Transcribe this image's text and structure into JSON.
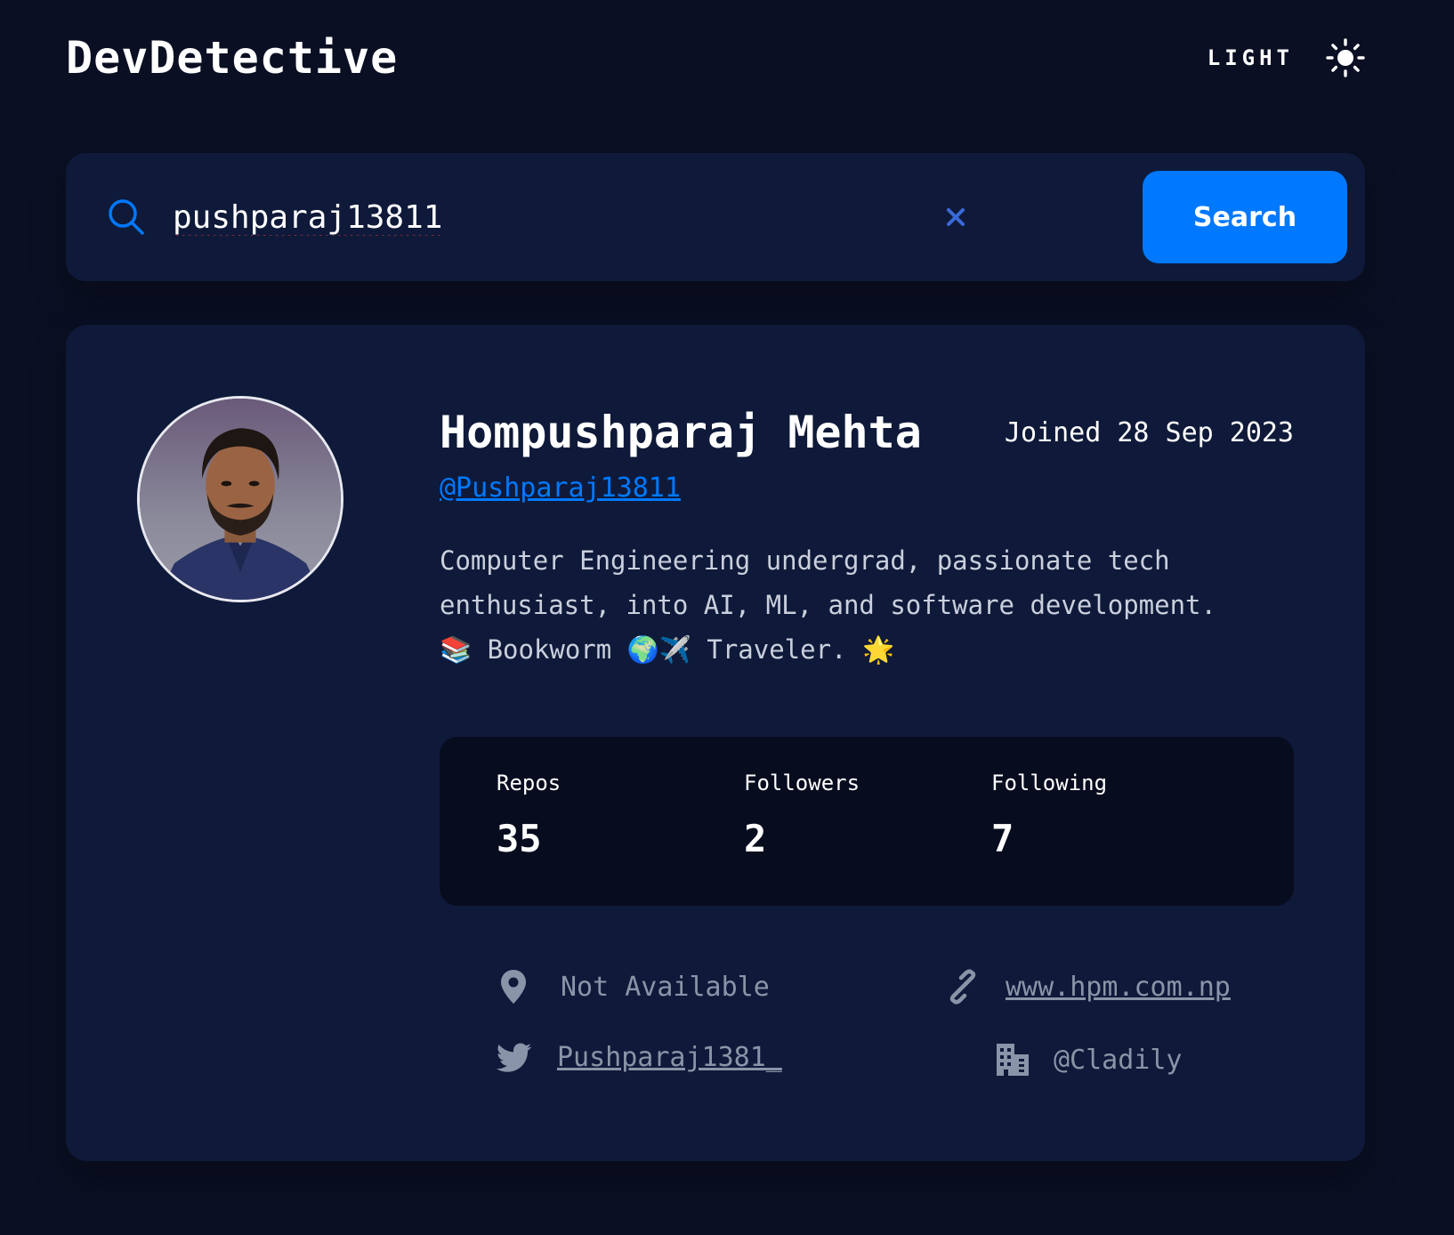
{
  "header": {
    "logo": "DevDetective",
    "theme_label": "LIGHT",
    "theme_icon": "sun-icon"
  },
  "search": {
    "value": "pushparaj13811",
    "placeholder": "",
    "button_label": "Search",
    "search_icon": "search-icon",
    "clear_icon": "close-icon"
  },
  "profile": {
    "name": "Hompushparaj Mehta",
    "joined": "Joined 28 Sep 2023",
    "username": "@Pushparaj13811",
    "bio_line1": "Computer Engineering undergrad, passionate tech",
    "bio_line2": "enthusiast, into AI, ML, and software development.",
    "bio_line3": "📚 Bookworm 🌍✈️ Traveler. 🌟"
  },
  "stats": [
    {
      "label": "Repos",
      "value": "35"
    },
    {
      "label": "Followers",
      "value": "2"
    },
    {
      "label": "Following",
      "value": "7"
    }
  ],
  "links": {
    "location": "Not Available",
    "website": "www.hpm.com.np",
    "twitter": "Pushparaj1381_",
    "company": "@Cladily"
  },
  "colors": {
    "background": "#0a0f23",
    "card": "#0f1a3a",
    "stats_bg": "#070c1f",
    "accent": "#0079ff",
    "muted": "#8a94a8"
  }
}
